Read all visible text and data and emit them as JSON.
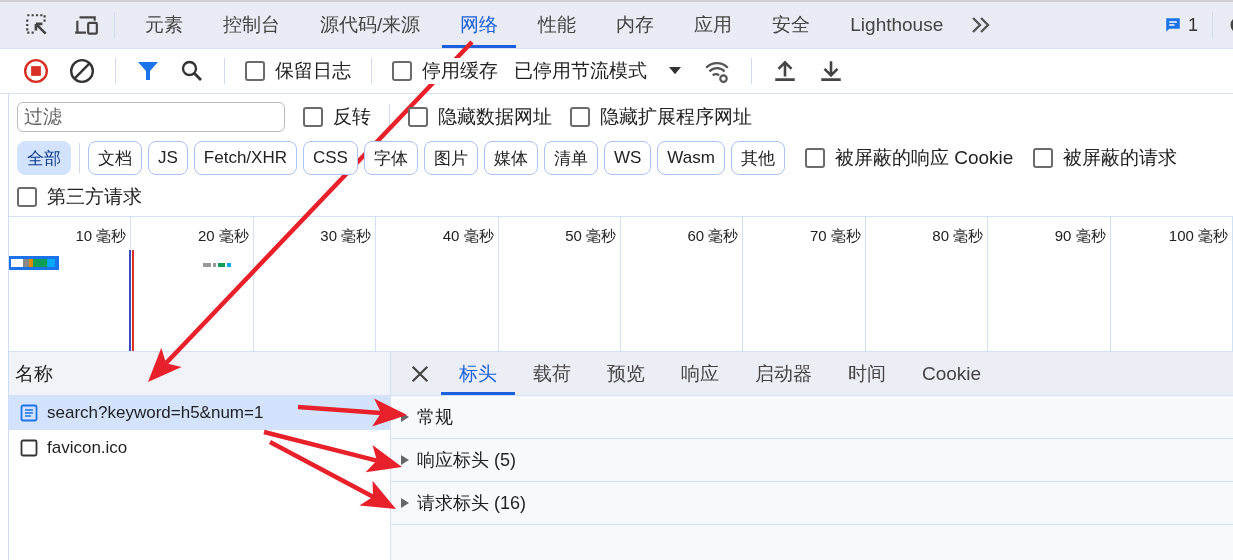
{
  "main_tabs": [
    {
      "label": "元素",
      "selected": false
    },
    {
      "label": "控制台",
      "selected": false
    },
    {
      "label": "源代码/来源",
      "selected": false
    },
    {
      "label": "网络",
      "selected": true
    },
    {
      "label": "性能",
      "selected": false
    },
    {
      "label": "内存",
      "selected": false
    },
    {
      "label": "应用",
      "selected": false
    },
    {
      "label": "安全",
      "selected": false
    },
    {
      "label": "Lighthouse",
      "selected": false
    }
  ],
  "issues_count": "1",
  "toolbar": {
    "checkboxes": [
      {
        "label": "保留日志",
        "checked": false
      },
      {
        "label": "停用缓存",
        "checked": false
      }
    ],
    "throttling": "已停用节流模式"
  },
  "filter": {
    "placeholder": "过滤",
    "checkboxes": [
      {
        "label": "反转",
        "checked": false
      },
      {
        "label": "隐藏数据网址",
        "checked": false
      },
      {
        "label": "隐藏扩展程序网址",
        "checked": false
      }
    ]
  },
  "type_filters": [
    {
      "label": "全部",
      "selected": true
    },
    {
      "label": "文档",
      "selected": false
    },
    {
      "label": "JS",
      "selected": false
    },
    {
      "label": "Fetch/XHR",
      "selected": false
    },
    {
      "label": "CSS",
      "selected": false
    },
    {
      "label": "字体",
      "selected": false
    },
    {
      "label": "图片",
      "selected": false
    },
    {
      "label": "媒体",
      "selected": false
    },
    {
      "label": "清单",
      "selected": false
    },
    {
      "label": "WS",
      "selected": false
    },
    {
      "label": "Wasm",
      "selected": false
    },
    {
      "label": "其他",
      "selected": false
    }
  ],
  "type_checkboxes": [
    {
      "label": "被屏蔽的响应 Cookie",
      "checked": false
    },
    {
      "label": "被屏蔽的请求",
      "checked": false
    }
  ],
  "third_party": {
    "label": "第三方请求",
    "checked": false
  },
  "timeline": {
    "ticks": [
      "10 毫秒",
      "20 毫秒",
      "30 毫秒",
      "40 毫秒",
      "50 毫秒",
      "60 毫秒",
      "70 毫秒",
      "80 毫秒",
      "90 毫秒",
      "100 毫秒"
    ]
  },
  "requests": {
    "column": "名称",
    "rows": [
      {
        "name": "search?keyword=h5&num=1",
        "kind": "document",
        "selected": true
      },
      {
        "name": "favicon.ico",
        "kind": "other",
        "selected": false
      }
    ]
  },
  "details": {
    "tabs": [
      {
        "label": "标头",
        "selected": true
      },
      {
        "label": "载荷",
        "selected": false
      },
      {
        "label": "预览",
        "selected": false
      },
      {
        "label": "响应",
        "selected": false
      },
      {
        "label": "启动器",
        "selected": false
      },
      {
        "label": "时间",
        "selected": false
      },
      {
        "label": "Cookie",
        "selected": false
      }
    ],
    "sections": [
      {
        "title": "常规",
        "expanded": false
      },
      {
        "title": "响应标头 (5)",
        "expanded": false
      },
      {
        "title": "请求标头 (16)",
        "expanded": false
      }
    ]
  }
}
